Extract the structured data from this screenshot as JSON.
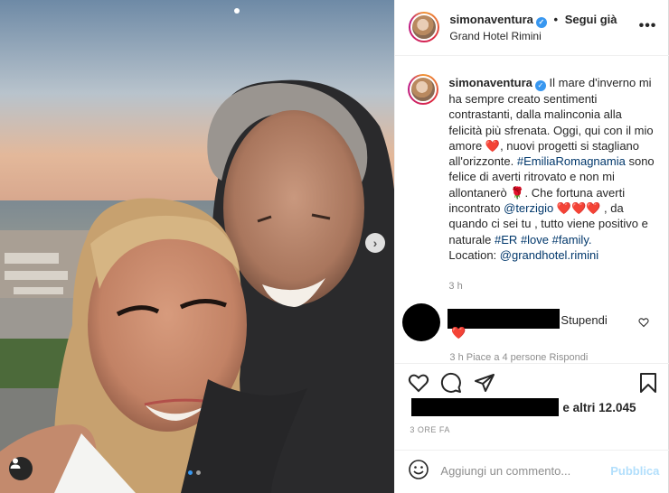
{
  "header": {
    "username": "simonaventura",
    "separator": "•",
    "follow_label": "Segui già",
    "location": "Grand Hotel Rimini",
    "more_label": "•••"
  },
  "caption": {
    "username": "simonaventura",
    "p1": "Il mare d'inverno mi ha sempre creato sentimenti contrastanti, dalla malinconia alla felicità più sfrenata. Oggi, qui con il mio amore",
    "p2": ", nuovi progetti si stagliano all'orizzonte.",
    "hashtag1": "#EmiliaRomagnamia",
    "p3": "sono felice di averti ritrovato e non mi allontanerò",
    "p4": ". Che fortuna averti incontrato",
    "mention": "@terzigio",
    "p5": ", da quando ci sei tu , tutto viene positivo e naturale",
    "hashtag2": "#ER",
    "hashtag3": "#love",
    "hashtag4": "#family.",
    "location_label": "Location:",
    "location_mention": "@grandhotel.rimini",
    "heart_emoji": "❤️",
    "rose_emoji": "🌹",
    "hearts3": "❤️❤️❤️",
    "time": "3 h"
  },
  "comment": {
    "text": "Stupendi",
    "heart_emoji": "❤️",
    "meta": "3 h    Piace a 4 persone    Rispondi"
  },
  "actions": {
    "likes_text": "e altri 12.045",
    "time_ago": "3 ORE FA"
  },
  "add_comment": {
    "placeholder": "Aggiungi un commento...",
    "publish_label": "Pubblica"
  },
  "colors": {
    "verified": "#3897f0",
    "link": "#00376b",
    "publish_disabled": "#b2dffc"
  }
}
